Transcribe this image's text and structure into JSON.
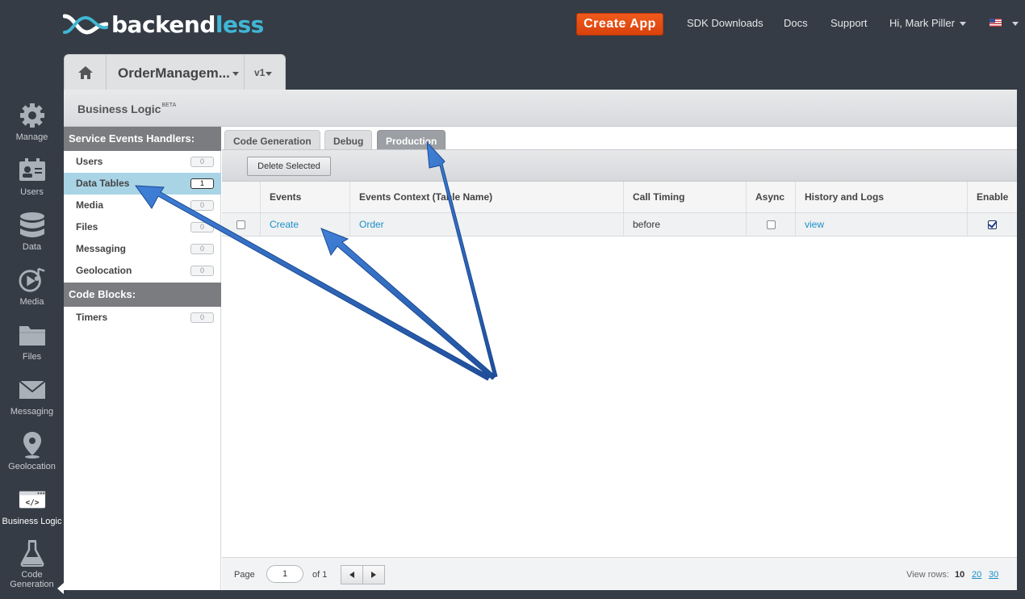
{
  "brand": {
    "part1": "backend",
    "part2": "less"
  },
  "topbar": {
    "create_app": "Create App",
    "sdk_downloads": "SDK Downloads",
    "docs": "Docs",
    "support": "Support",
    "user": "Hi, Mark Piller"
  },
  "app": {
    "name": "OrderManagem...",
    "version": "v1"
  },
  "nav": {
    "manage": "Manage",
    "users": "Users",
    "data": "Data",
    "media": "Media",
    "files": "Files",
    "messaging": "Messaging",
    "geolocation": "Geolocation",
    "business_logic": "Business Logic",
    "code_generation": "Code Generation"
  },
  "page": {
    "title": "Business Logic",
    "beta": "BETA"
  },
  "sidebar": {
    "service_header": "Service Events Handlers:",
    "items": [
      {
        "label": "Users",
        "count": "0"
      },
      {
        "label": "Data Tables",
        "count": "1"
      },
      {
        "label": "Media",
        "count": "0"
      },
      {
        "label": "Files",
        "count": "0"
      },
      {
        "label": "Messaging",
        "count": "0"
      },
      {
        "label": "Geolocation",
        "count": "0"
      }
    ],
    "code_header": "Code Blocks:",
    "timers": {
      "label": "Timers",
      "count": "0"
    }
  },
  "tabs": {
    "code_generation": "Code Generation",
    "debug": "Debug",
    "production": "Production"
  },
  "toolbar": {
    "delete_selected": "Delete Selected"
  },
  "table": {
    "headers": [
      "Events",
      "Events Context (Table Name)",
      "Call Timing",
      "Async",
      "History and Logs",
      "Enable"
    ],
    "rows": [
      {
        "event": "Create",
        "context": "Order",
        "timing": "before",
        "async": false,
        "history": "view",
        "enabled": true
      }
    ]
  },
  "pager": {
    "page_label": "Page",
    "page": "1",
    "of_label": "of 1",
    "view_rows_label": "View rows:",
    "opt10": "10",
    "opt20": "20",
    "opt30": "30"
  },
  "colors": {
    "accent": "#41b6d4",
    "create_button": "#e54e14",
    "arrow": "#2a62b8",
    "selected_row": "#a9d4e6"
  },
  "icons": {
    "home": "home-icon",
    "manage": "gear-icon",
    "users": "id-card-icon",
    "data": "database-icon",
    "media": "play-note-icon",
    "files": "folder-icon",
    "messaging": "envelope-icon",
    "geolocation": "map-pin-icon",
    "business_logic": "code-icon",
    "code_generation": "flask-icon"
  }
}
